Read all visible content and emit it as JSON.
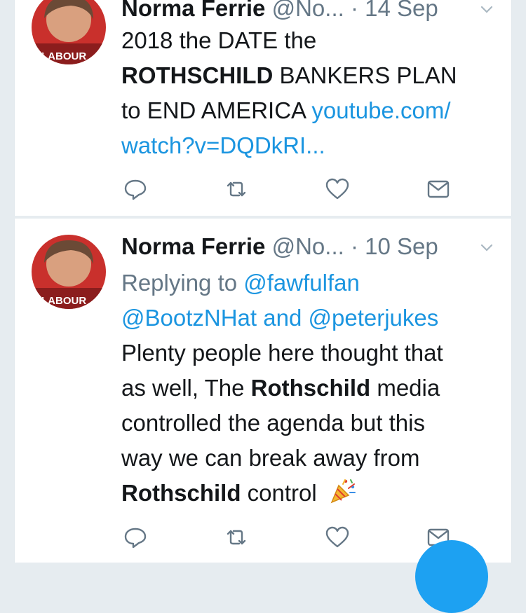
{
  "tweets": [
    {
      "author_name": "Norma Ferrie",
      "handle": "@No...",
      "separator": "·",
      "date": "14 Sep",
      "text": {
        "line1": "2018 the DATE the",
        "line2_bold": "ROTHSCHILD",
        "line2_rest": " BANKERS PLAN",
        "line3_plain": "to END AMERICA ",
        "line3_link": "youtube.com/",
        "line4_link": "watch?v=DQDkRI..."
      },
      "avatar_text": "LABOUR"
    },
    {
      "author_name": "Norma Ferrie",
      "handle": "@No...",
      "separator": "·",
      "date": "10 Sep",
      "reply": {
        "prefix": "Replying to ",
        "user1": "@fawfulfan",
        "user2": "@BootzNHat",
        "conjunction": " and ",
        "user3": "@peterjukes"
      },
      "text": {
        "line1": "Plenty people here thought that",
        "line2_plain": "as well, The ",
        "line2_bold": "Rothschild",
        "line2_rest": " media",
        "line3": "controlled the agenda but this",
        "line4": "way we can break away from",
        "line5_bold": "Rothschild",
        "line5_rest": " control"
      },
      "emoji_name": "party-popper",
      "avatar_text": "LABOUR"
    }
  ],
  "icons": [
    "reply-icon",
    "retweet-icon",
    "like-icon",
    "direct-message-icon",
    "chevron-down-icon",
    "compose-icon"
  ],
  "colors": {
    "link": "#1b95e0",
    "secondary": "#657786",
    "text": "#14171a",
    "background": "#e6ecf0",
    "accent": "#1da1f2"
  }
}
